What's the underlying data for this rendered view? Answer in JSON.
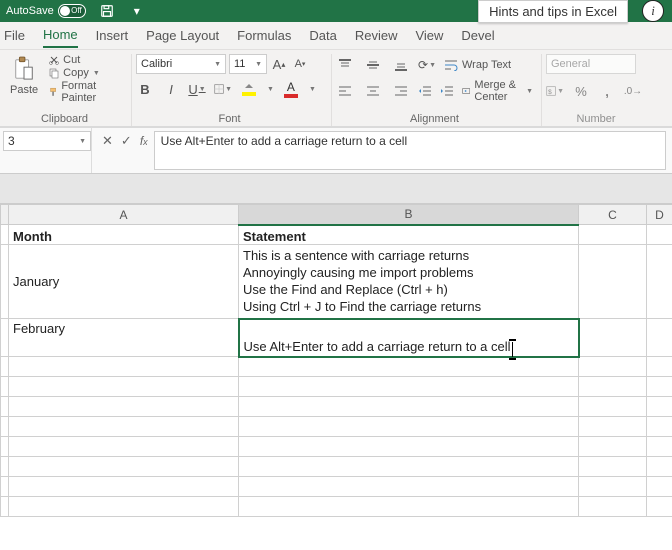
{
  "titlebar": {
    "autosave_label": "AutoSave",
    "autosave_state": "Off",
    "tooltip": "Hints and tips in Excel"
  },
  "tabs": [
    "File",
    "Home",
    "Insert",
    "Page Layout",
    "Formulas",
    "Data",
    "Review",
    "View",
    "Devel"
  ],
  "active_tab": "Home",
  "ribbon": {
    "clipboard": {
      "paste": "Paste",
      "cut": "Cut",
      "copy": "Copy",
      "fp": "Format Painter",
      "label": "Clipboard"
    },
    "font": {
      "name": "Calibri",
      "size": "11",
      "label": "Font"
    },
    "alignment": {
      "wrap": "Wrap Text",
      "merge": "Merge & Center",
      "label": "Alignment"
    },
    "number": {
      "format": "General",
      "label": "Number"
    }
  },
  "namebox": "3",
  "formula": "Use Alt+Enter to add a carriage return to a cell",
  "columns": [
    "A",
    "B",
    "C",
    "D"
  ],
  "sheet": {
    "hA": "Month",
    "hB": "Statement",
    "r1A": "January",
    "r1B_1": "This is a sentence with carriage returns",
    "r1B_2": "Annoyingly causing me import problems",
    "r1B_3": "Use the Find and Replace (Ctrl + h)",
    "r1B_4": "Using Ctrl + J to Find the carriage returns",
    "r2A": "February",
    "r2B": "Use Alt+Enter to add a carriage return to a cell"
  }
}
